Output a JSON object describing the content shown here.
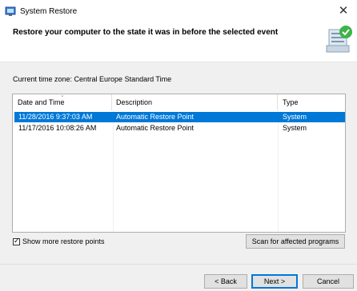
{
  "window": {
    "title": "System Restore",
    "close_symbol": "✕"
  },
  "header": {
    "title": "Restore your computer to the state it was in before the selected event"
  },
  "timezone": "Current time zone: Central Europe Standard Time",
  "table": {
    "columns": [
      "Date and Time",
      "Description",
      "Type"
    ],
    "rows": [
      {
        "date": "11/28/2016 9:37:03 AM",
        "description": "Automatic Restore Point",
        "type": "System",
        "selected": true
      },
      {
        "date": "11/17/2016 10:08:26 AM",
        "description": "Automatic Restore Point",
        "type": "System",
        "selected": false
      }
    ]
  },
  "show_more": {
    "label": "Show more restore points",
    "checked": true
  },
  "scan_button": "Scan for affected programs",
  "buttons": {
    "back": "< Back",
    "next": "Next >",
    "cancel": "Cancel"
  },
  "colors": {
    "selection": "#0078d7",
    "panel": "#f0f0f0"
  },
  "icons": {
    "window": "system-restore-icon",
    "header": "system-restore-large-icon",
    "sort": "sort-caret-icon"
  }
}
